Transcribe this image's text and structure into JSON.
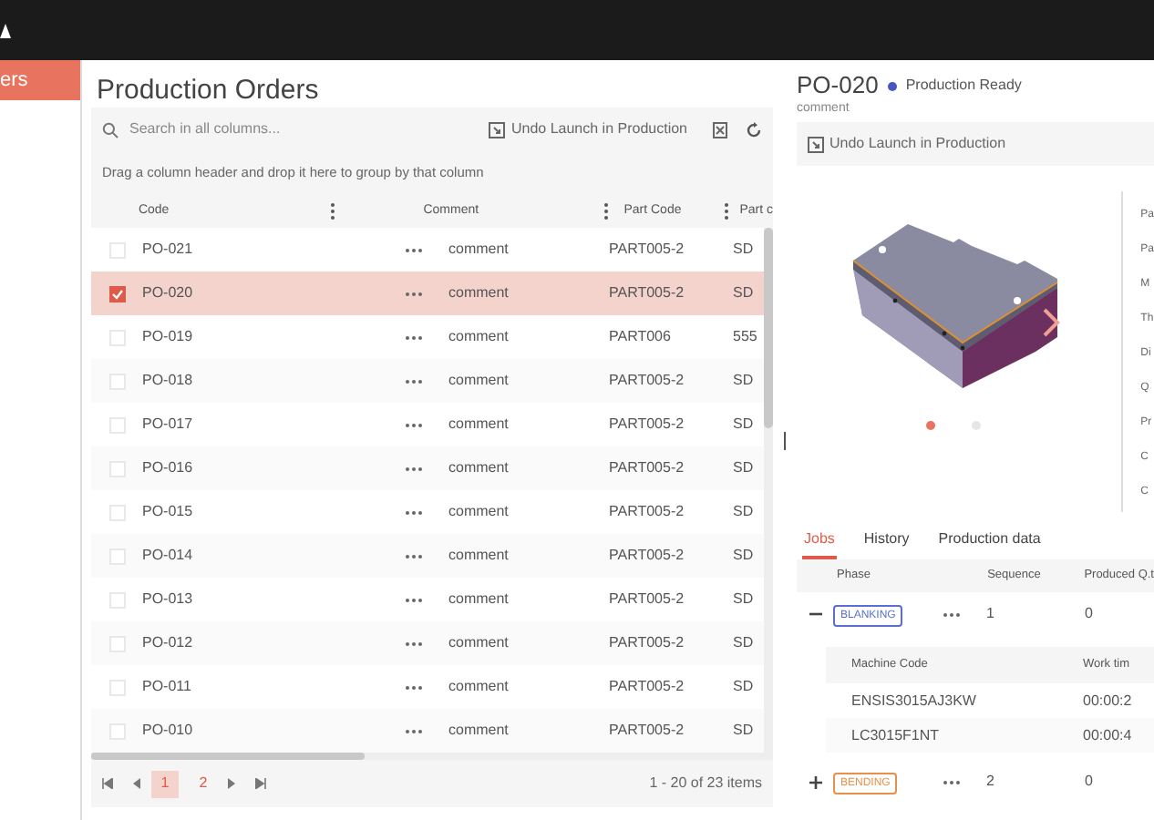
{
  "sidebar": {
    "items": [
      {
        "label": "ers",
        "selected": true
      }
    ]
  },
  "orders": {
    "title": "Production Orders",
    "search": {
      "placeholder": "Search in all columns..."
    },
    "toolbar_action": "Undo Launch in Production",
    "group_hint": "Drag a column header and drop it here to group by that column",
    "columns": [
      "Code",
      "Comment",
      "Part Code",
      "Part c"
    ],
    "rows": [
      {
        "code": "PO-021",
        "comment": "comment",
        "part_code": "PART005-2",
        "column_4": "SD",
        "selected": false
      },
      {
        "code": "PO-020",
        "comment": "comment",
        "part_code": "PART005-2",
        "column_4": "SD",
        "selected": true
      },
      {
        "code": "PO-019",
        "comment": "comment",
        "part_code": "PART006",
        "column_4": "555",
        "selected": false
      },
      {
        "code": "PO-018",
        "comment": "comment",
        "part_code": "PART005-2",
        "column_4": "SD",
        "selected": false
      },
      {
        "code": "PO-017",
        "comment": "comment",
        "part_code": "PART005-2",
        "column_4": "SD",
        "selected": false
      },
      {
        "code": "PO-016",
        "comment": "comment",
        "part_code": "PART005-2",
        "column_4": "SD",
        "selected": false
      },
      {
        "code": "PO-015",
        "comment": "comment",
        "part_code": "PART005-2",
        "column_4": "SD",
        "selected": false
      },
      {
        "code": "PO-014",
        "comment": "comment",
        "part_code": "PART005-2",
        "column_4": "SD",
        "selected": false
      },
      {
        "code": "PO-013",
        "comment": "comment",
        "part_code": "PART005-2",
        "column_4": "SD",
        "selected": false
      },
      {
        "code": "PO-012",
        "comment": "comment",
        "part_code": "PART005-2",
        "column_4": "SD",
        "selected": false
      },
      {
        "code": "PO-011",
        "comment": "comment",
        "part_code": "PART005-2",
        "column_4": "SD",
        "selected": false
      },
      {
        "code": "PO-010",
        "comment": "comment",
        "part_code": "PART005-2",
        "column_4": "SD",
        "selected": false
      }
    ],
    "pager": {
      "pages": [
        {
          "label": "1",
          "selected": true
        },
        {
          "label": "2",
          "selected": false
        }
      ],
      "summary": "1 - 20 of 23 items"
    }
  },
  "detail": {
    "title": "PO-020",
    "status": {
      "label": "Production Ready",
      "color": "#4657c4"
    },
    "comment": "comment",
    "toolbar_action": "Undo Launch in Production",
    "carousel": {
      "slides": [
        {
          "selected": true
        },
        {
          "selected": false
        }
      ]
    },
    "properties": [
      "Pa",
      "Pa",
      "M",
      "Th",
      "Di",
      "Q",
      "Pr",
      "C",
      "C"
    ],
    "tabs": [
      {
        "label": "Jobs",
        "selected": true
      },
      {
        "label": "History",
        "selected": false
      },
      {
        "label": "Production data",
        "selected": false
      }
    ],
    "jobs": {
      "columns": [
        "Phase",
        "Sequence",
        "Produced Q.t"
      ],
      "rows": [
        {
          "phase": "BLANKING",
          "color": "#5a6fd0",
          "sequence": "1",
          "produced": "0",
          "expanded": true,
          "machines": {
            "columns": [
              "Machine Code",
              "Work tim"
            ],
            "rows": [
              {
                "code": "ENSIS3015AJ3KW",
                "time": "00:00:2"
              },
              {
                "code": "LC3015F1NT",
                "time": "00:00:4"
              }
            ]
          }
        },
        {
          "phase": "BENDING",
          "color": "#e8904a",
          "sequence": "2",
          "produced": "0",
          "expanded": false
        }
      ]
    }
  }
}
